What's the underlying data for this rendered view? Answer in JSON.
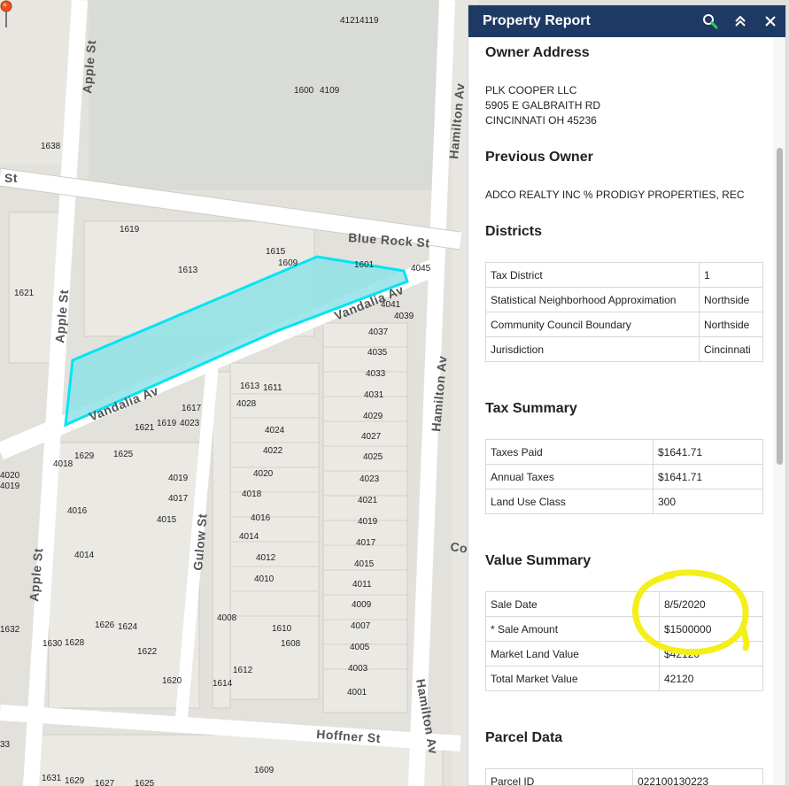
{
  "panel": {
    "title": "Property Report",
    "buttons": [
      "search",
      "collapse",
      "close"
    ],
    "owner_address": {
      "heading": "Owner Address",
      "lines": [
        "PLK COOPER LLC",
        "5905 E GALBRAITH RD",
        "CINCINNATI OH 45236"
      ]
    },
    "previous_owner": {
      "heading": "Previous Owner",
      "value": "ADCO REALTY INC % PRODIGY PROPERTIES, REC"
    },
    "districts": {
      "heading": "Districts",
      "rows": [
        [
          "Tax District",
          "1"
        ],
        [
          "Statistical Neighborhood Approximation",
          "Northside"
        ],
        [
          "Community Council Boundary",
          "Northside"
        ],
        [
          "Jurisdiction",
          "Cincinnati"
        ]
      ]
    },
    "tax_summary": {
      "heading": "Tax Summary",
      "rows": [
        [
          "Taxes Paid",
          "$1641.71"
        ],
        [
          "Annual Taxes",
          "$1641.71"
        ],
        [
          "Land Use Class",
          "300"
        ]
      ]
    },
    "value_summary": {
      "heading": "Value Summary",
      "rows": [
        [
          "Sale Date",
          "8/5/2020"
        ],
        [
          "* Sale Amount",
          "$1500000"
        ],
        [
          "Market Land Value",
          "$42120"
        ],
        [
          "Total Market Value",
          "42120"
        ]
      ]
    },
    "parcel_data": {
      "heading": "Parcel Data",
      "rows": [
        [
          "Parcel ID",
          "022100130223"
        ]
      ]
    }
  },
  "map": {
    "streets": [
      "Apple St",
      "Apple St",
      "Apple St",
      "Blue Rock St",
      "Hamilton Av",
      "Hamilton Av",
      "Hamilton Av",
      "Vandalia Av",
      "Vandalia Av",
      "Gulow St",
      "Hoffner St",
      "St",
      "Co"
    ],
    "parcel_numbers": [
      "4121",
      "4119",
      "1600",
      "4109",
      "1638",
      "1619",
      "1615",
      "1609",
      "1601",
      "4045",
      "1613",
      "1621",
      "4041",
      "4039",
      "4037",
      "4035",
      "4033",
      "4031",
      "4029",
      "4027",
      "4025",
      "4023",
      "4021",
      "4019",
      "4017",
      "4015",
      "4011",
      "4009",
      "4007",
      "4005",
      "4003",
      "4001",
      "1613",
      "1611",
      "4028",
      "4024",
      "4022",
      "4020",
      "4018",
      "4016",
      "4014",
      "4012",
      "4010",
      "4008",
      "1610",
      "1608",
      "1612",
      "1614",
      "1617",
      "1621",
      "1619",
      "4023",
      "1629",
      "1625",
      "4018",
      "4019",
      "4017",
      "4016",
      "4015",
      "4014",
      "1626",
      "1624",
      "1630",
      "1628",
      "1622",
      "1620",
      "1632",
      "4020",
      "4019",
      "1631",
      "1629",
      "1627",
      "1625",
      "1609",
      "33"
    ],
    "selected_parcel_color": "#00e5f2",
    "highlight_color": "#f4ef1a"
  }
}
